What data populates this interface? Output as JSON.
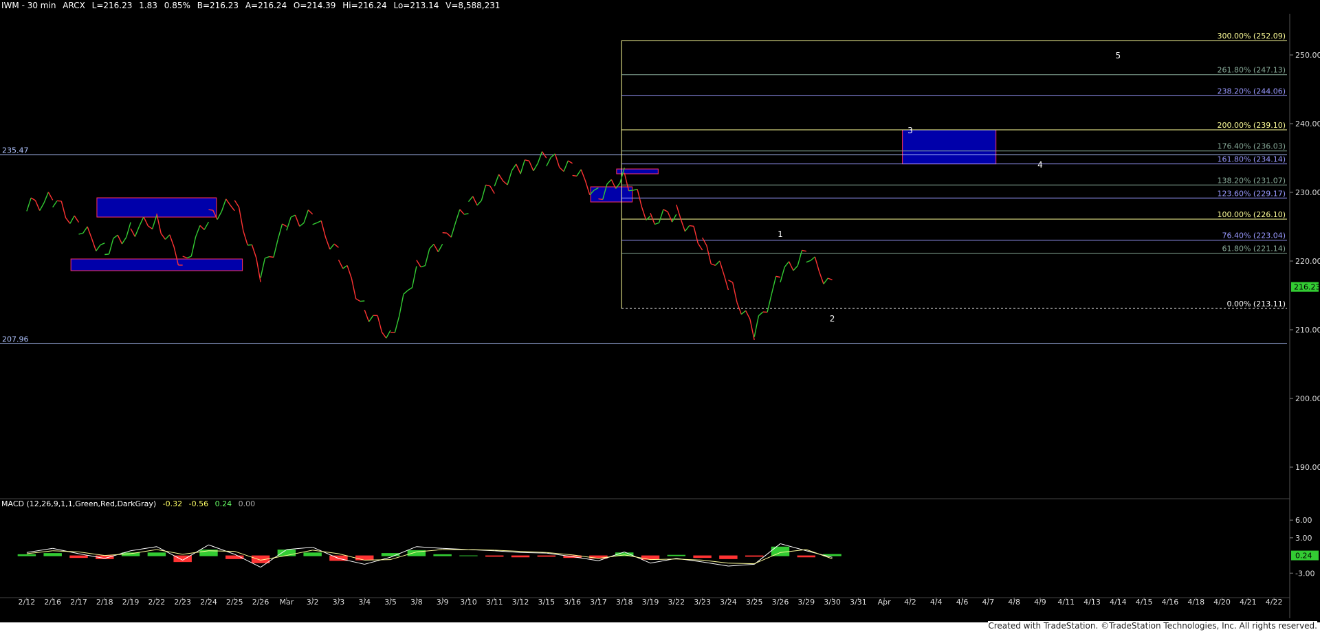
{
  "header": {
    "symbol_interval": "IWM - 30 min",
    "exchange": "ARCX",
    "last": "L=216.23",
    "change": "1.83",
    "change_pct": "0.85%",
    "bid": "B=216.23",
    "ask": "A=216.24",
    "open": "O=214.39",
    "high": "Hi=216.24",
    "low": "Lo=213.14",
    "volume": "V=8,588,231"
  },
  "macd_header": {
    "name": "MACD (12,26,9,1,1,Green,Red,DarkGray)",
    "v1": "-0.32",
    "v2": "-0.56",
    "v3": "0.24",
    "v4": "0.00"
  },
  "footer": "Created with TradeStation. ©TradeStation Technologies, Inc. All rights reserved.",
  "colors": {
    "up": "#33cc33",
    "down": "#ff3333",
    "fib_yellow": "#ffff99",
    "fib_blue": "#9999ff",
    "fib_green": "#88aa99",
    "zone_fill": "#0000aa",
    "zone_border": "#ff3366",
    "hline": "#b0c4ff",
    "axis_text": "#dddddd"
  },
  "chart_data": {
    "type": "line",
    "title": "IWM - 30 min",
    "price_axis": {
      "ticks": [
        190.0,
        200.0,
        210.0,
        220.0,
        230.0,
        240.0,
        250.0
      ],
      "tick_labels": [
        "190.00",
        "200.00",
        "210.00",
        "220.00",
        "230.00",
        "240.00",
        "250.00"
      ],
      "ylim": [
        186,
        256
      ]
    },
    "x_tick_labels": [
      "2/12",
      "2/16",
      "2/17",
      "2/18",
      "2/19",
      "2/22",
      "2/23",
      "2/24",
      "2/25",
      "2/26",
      "Mar",
      "3/2",
      "3/3",
      "3/4",
      "3/5",
      "3/8",
      "3/9",
      "3/10",
      "3/11",
      "3/12",
      "3/15",
      "3/16",
      "3/17",
      "3/18",
      "3/19",
      "3/22",
      "3/23",
      "3/24",
      "3/25",
      "3/26",
      "3/29",
      "3/30",
      "3/31",
      "Apr",
      "4/2",
      "4/4",
      "4/6",
      "4/7",
      "4/8",
      "4/9",
      "4/11",
      "4/13",
      "4/14",
      "4/15",
      "4/16",
      "4/18",
      "4/20",
      "4/21",
      "4/22"
    ],
    "last_price_label": "216.23",
    "last_price": 216.23,
    "hlines": [
      {
        "label": "235.47",
        "value": 235.47
      },
      {
        "label": "207.96",
        "value": 207.96
      }
    ],
    "fib_levels": [
      {
        "label": "300.00% (252.09)",
        "value": 252.09,
        "color": "yellow"
      },
      {
        "label": "261.80% (247.13)",
        "value": 247.13,
        "color": "green"
      },
      {
        "label": "238.20% (244.06)",
        "value": 244.06,
        "color": "blue"
      },
      {
        "label": "200.00% (239.10)",
        "value": 239.1,
        "color": "yellow"
      },
      {
        "label": "176.40% (236.03)",
        "value": 236.03,
        "color": "green"
      },
      {
        "label": "161.80% (234.14)",
        "value": 234.14,
        "color": "blue"
      },
      {
        "label": "138.20% (231.07)",
        "value": 231.07,
        "color": "green"
      },
      {
        "label": "123.60% (229.17)",
        "value": 229.17,
        "color": "blue"
      },
      {
        "label": "100.00% (226.10)",
        "value": 226.1,
        "color": "yellow"
      },
      {
        "label": "76.40% (223.04)",
        "value": 223.04,
        "color": "blue"
      },
      {
        "label": "61.80% (221.14)",
        "value": 221.14,
        "color": "green"
      },
      {
        "label": "0.00% (213.11)",
        "value": 213.11,
        "color": "white"
      }
    ],
    "wave_labels": [
      {
        "text": "1",
        "x": "3/26",
        "y": 223.5
      },
      {
        "text": "2",
        "x": "3/30",
        "y": 211.2
      },
      {
        "text": "3",
        "x": "4/2",
        "y": 238.6
      },
      {
        "text": "4",
        "x": "4/9",
        "y": 233.6
      },
      {
        "text": "5",
        "x": "4/14",
        "y": 249.5
      }
    ],
    "zones": [
      {
        "x_from": "2/18",
        "x_to": "2/24",
        "y_low": 226.4,
        "y_high": 229.2
      },
      {
        "x_from": "2/17",
        "x_to": "2/25",
        "y_low": 218.6,
        "y_high": 220.3
      },
      {
        "x_from": "3/17",
        "x_to": "3/18",
        "y_low": 228.6,
        "y_high": 230.8
      },
      {
        "x_from": "3/18",
        "x_to": "3/19",
        "y_low": 232.7,
        "y_high": 233.4
      },
      {
        "x_from": "4/2",
        "x_to": "4/7",
        "y_low": 234.14,
        "y_high": 239.1
      }
    ],
    "price_series": [
      {
        "x": "2/12",
        "y": 228.0
      },
      {
        "x": "2/16",
        "y": 229.0
      },
      {
        "x": "2/17",
        "y": 225.0
      },
      {
        "x": "2/18",
        "y": 221.5
      },
      {
        "x": "2/19",
        "y": 224.5
      },
      {
        "x": "2/22",
        "y": 226.0
      },
      {
        "x": "2/23",
        "y": 219.5
      },
      {
        "x": "2/24",
        "y": 226.5
      },
      {
        "x": "2/25",
        "y": 228.5
      },
      {
        "x": "2/26",
        "y": 218.0
      },
      {
        "x": "Mar",
        "y": 225.5
      },
      {
        "x": "3/2",
        "y": 226.5
      },
      {
        "x": "3/3",
        "y": 221.0
      },
      {
        "x": "3/4",
        "y": 213.0
      },
      {
        "x": "3/5",
        "y": 209.0
      },
      {
        "x": "3/8",
        "y": 219.0
      },
      {
        "x": "3/9",
        "y": 223.0
      },
      {
        "x": "3/10",
        "y": 228.0
      },
      {
        "x": "3/11",
        "y": 231.0
      },
      {
        "x": "3/12",
        "y": 233.5
      },
      {
        "x": "3/15",
        "y": 235.0
      },
      {
        "x": "3/16",
        "y": 233.5
      },
      {
        "x": "3/17",
        "y": 229.5
      },
      {
        "x": "3/18",
        "y": 232.5
      },
      {
        "x": "3/19",
        "y": 226.0
      },
      {
        "x": "3/22",
        "y": 227.0
      },
      {
        "x": "3/23",
        "y": 222.5
      },
      {
        "x": "3/24",
        "y": 217.0
      },
      {
        "x": "3/25",
        "y": 209.5
      },
      {
        "x": "3/26",
        "y": 218.0
      },
      {
        "x": "3/29",
        "y": 221.0
      },
      {
        "x": "3/30",
        "y": 216.23
      }
    ],
    "macd_axis": {
      "ticks": [
        -3.0,
        3.0,
        6.0
      ],
      "tick_labels": [
        "-3.00",
        "3.00",
        "6.00"
      ],
      "current_label": "0.24",
      "ylim": [
        -6,
        8
      ]
    },
    "macd_series": [
      {
        "name": "MACD",
        "values": [
          0.5,
          1.2,
          0.3,
          -0.5,
          0.8,
          1.5,
          -0.8,
          1.8,
          0.2,
          -2.0,
          1.0,
          1.4,
          -0.5,
          -1.5,
          -0.3,
          1.5,
          1.2,
          1.0,
          0.8,
          0.5,
          0.4,
          -0.2,
          -0.9,
          0.6,
          -1.3,
          -0.5,
          -1.1,
          -1.8,
          -1.5,
          2.0,
          0.8,
          -0.32
        ]
      },
      {
        "name": "Signal",
        "values": [
          0.3,
          0.8,
          0.6,
          0.0,
          0.3,
          1.0,
          0.2,
          0.8,
          0.7,
          -0.8,
          0.0,
          0.9,
          0.3,
          -0.8,
          -0.7,
          0.6,
          1.0,
          1.0,
          0.9,
          0.7,
          0.5,
          0.1,
          -0.5,
          0.1,
          -0.7,
          -0.6,
          -0.8,
          -1.3,
          -1.4,
          0.5,
          1.0,
          -0.56
        ]
      }
    ]
  }
}
